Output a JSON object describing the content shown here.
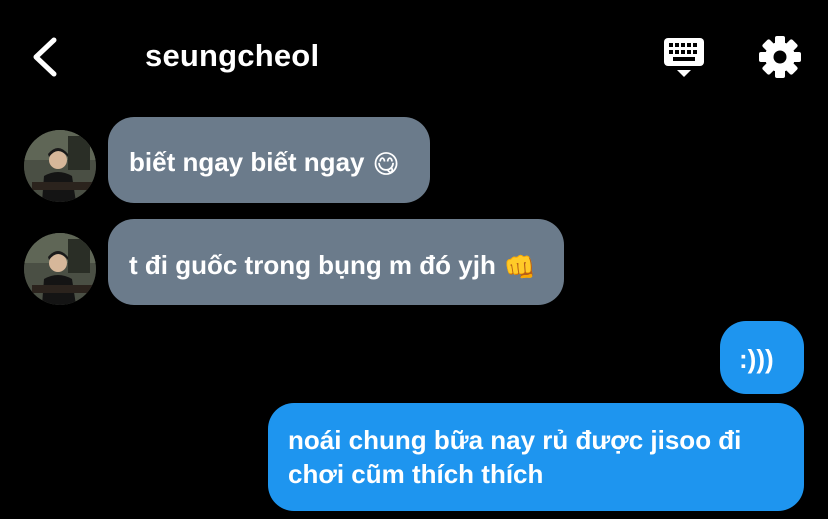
{
  "header": {
    "title": "seungcheol"
  },
  "messages": [
    {
      "side": "incoming",
      "text": "biết ngay biết ngay",
      "emoji": "😋"
    },
    {
      "side": "incoming",
      "text": "t đi guốc trong bụng m đó yjh",
      "emoji": "👊"
    },
    {
      "side": "outgoing",
      "text": ":)))"
    },
    {
      "side": "outgoing",
      "line1": "noái chung bữa nay rủ được jisoo đi",
      "line2": "chơi cũm thích thích"
    }
  ],
  "colors": {
    "background": "#000000",
    "incoming_bubble": "#6b7b8b",
    "outgoing_bubble": "#1e95ef",
    "text": "#ffffff"
  },
  "icons": [
    "back-chevron-icon",
    "keyboard-icon",
    "gear-icon"
  ]
}
